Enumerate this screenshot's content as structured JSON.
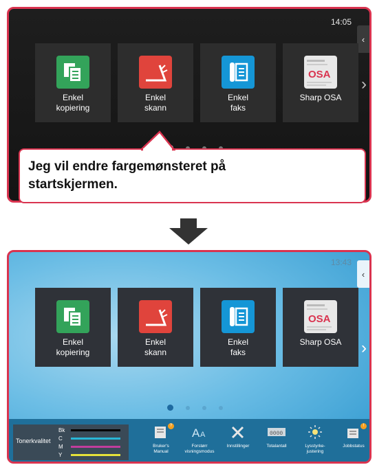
{
  "top_screen": {
    "time": "14:05",
    "tiles": [
      {
        "label": "Enkel\nkopiering"
      },
      {
        "label": "Enkel\nskann"
      },
      {
        "label": "Enkel\nfaks"
      },
      {
        "label": "Sharp OSA"
      }
    ],
    "osa_logo": "OSA"
  },
  "callout": {
    "text": "Jeg vil endre fargemønsteret på\nstartskjermen."
  },
  "bottom_screen": {
    "time": "13:43",
    "tiles": [
      {
        "label": "Enkel\nkopiering"
      },
      {
        "label": "Enkel\nskann"
      },
      {
        "label": "Enkel\nfaks"
      },
      {
        "label": "Sharp OSA"
      }
    ],
    "osa_logo": "OSA",
    "toner": {
      "label": "Tonerkvalitet",
      "rows": [
        {
          "key": "Bk",
          "color": "#000000"
        },
        {
          "key": "C",
          "color": "#29b6d6"
        },
        {
          "key": "M",
          "color": "#c23d9d"
        },
        {
          "key": "Y",
          "color": "#e6e23a"
        }
      ]
    },
    "status_buttons": [
      {
        "label": "Bruker's\nManual",
        "icon": "book-icon",
        "badge": "?"
      },
      {
        "label": "Forstørr\nvisningsmodus",
        "icon": "text-size-icon"
      },
      {
        "label": "Innstillinger",
        "icon": "tools-icon"
      },
      {
        "label": "Totalantall",
        "icon": "counter-icon",
        "counter": "0000"
      },
      {
        "label": "Lysstyrke-\njustering",
        "icon": "brightness-icon"
      },
      {
        "label": "Jobbstatus",
        "icon": "job-status-icon",
        "badge": "!"
      }
    ]
  },
  "colors": {
    "accent": "#d9334f"
  }
}
